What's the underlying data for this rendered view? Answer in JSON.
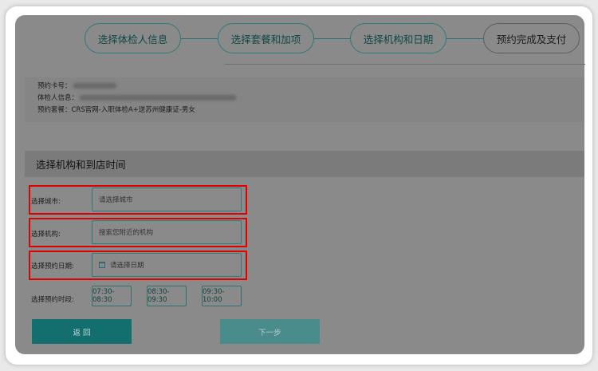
{
  "stepper": {
    "steps": [
      {
        "label": "选择体检人信息"
      },
      {
        "label": "选择套餐和加项"
      },
      {
        "label": "选择机构和日期"
      },
      {
        "label": "预约完成及支付"
      }
    ]
  },
  "info": {
    "card_no_label": "预约卡号：",
    "examinee_label": "体检人信息：",
    "package_label": "预约套餐：",
    "package_value": "CRS官网-入职体检A+送苏州健康证-男女"
  },
  "section": {
    "title": "选择机构和到店时间"
  },
  "form": {
    "city_label": "选择城市:",
    "city_placeholder": "请选择城市",
    "org_label": "选择机构:",
    "org_placeholder": "搜索您附近的机构",
    "date_label": "选择预约日期:",
    "date_placeholder": "请选择日期",
    "time_label": "选择预约时段:",
    "time_slots": [
      "07:30-08:30",
      "08:30-09:30",
      "09:30-10:00"
    ]
  },
  "actions": {
    "back_label": "返 回",
    "next_label": "下一步"
  },
  "colors": {
    "accent": "#136e6e",
    "highlight": "#e00000"
  }
}
